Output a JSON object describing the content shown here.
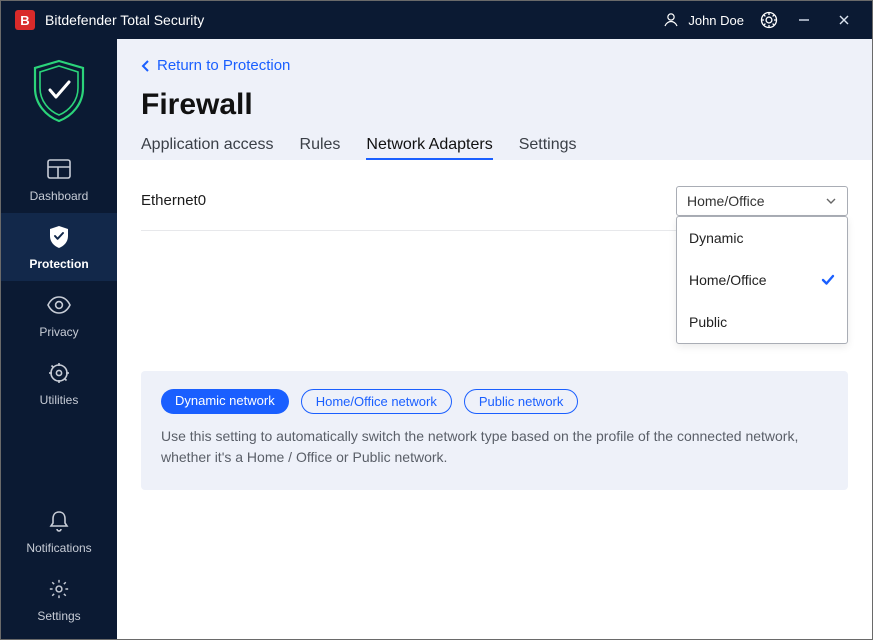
{
  "app": {
    "title": "Bitdefender Total Security",
    "logo_letter": "B"
  },
  "titlebar": {
    "user_name": "John Doe"
  },
  "sidebar": {
    "items": [
      {
        "label": "Dashboard"
      },
      {
        "label": "Protection"
      },
      {
        "label": "Privacy"
      },
      {
        "label": "Utilities"
      }
    ],
    "bottom": [
      {
        "label": "Notifications"
      },
      {
        "label": "Settings"
      }
    ]
  },
  "header": {
    "back_label": "Return to Protection",
    "page_title": "Firewall",
    "tabs": [
      {
        "label": "Application access"
      },
      {
        "label": "Rules"
      },
      {
        "label": "Network Adapters"
      },
      {
        "label": "Settings"
      }
    ]
  },
  "adapter": {
    "name": "Ethernet0",
    "selected": "Home/Office",
    "options": [
      {
        "label": "Dynamic",
        "checked": false
      },
      {
        "label": "Home/Office",
        "checked": true
      },
      {
        "label": "Public",
        "checked": false
      }
    ]
  },
  "info": {
    "chips": [
      {
        "label": "Dynamic network",
        "active": true
      },
      {
        "label": "Home/Office network",
        "active": false
      },
      {
        "label": "Public network",
        "active": false
      }
    ],
    "text": "Use this setting to automatically switch the network type based on the profile of the connected network, whether it's a Home / Office or Public network."
  }
}
